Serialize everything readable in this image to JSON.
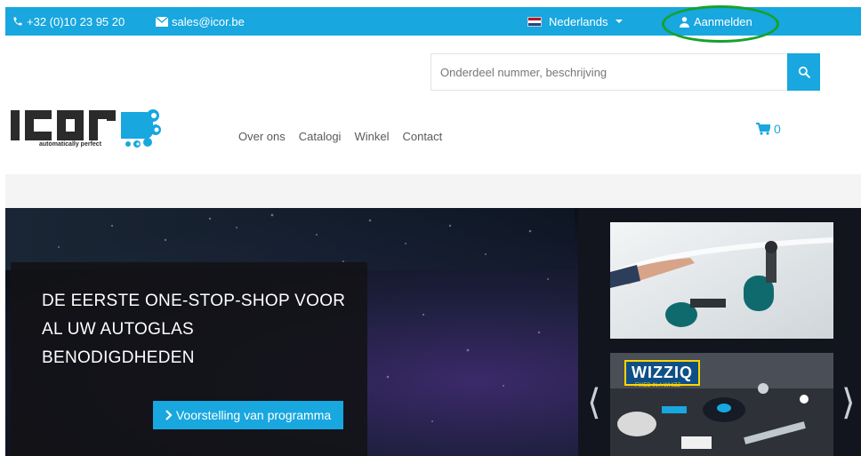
{
  "topbar": {
    "phone": "+32 (0)10 23 95 20",
    "email": "sales@icor.be",
    "language": "Nederlands",
    "login": "Aanmelden",
    "icons": {
      "phone": "phone-icon",
      "email": "envelope-icon",
      "flag": "netherlands-flag-icon",
      "login": "user-icon"
    }
  },
  "search": {
    "placeholder": "Onderdeel nummer, beschrijving",
    "value": "",
    "button_icon": "search-icon"
  },
  "logo": {
    "brand": "icor",
    "tagline": "automatically perfect"
  },
  "nav": {
    "items": [
      "Over ons",
      "Catalogi",
      "Winkel",
      "Contact"
    ]
  },
  "cart": {
    "count": "0",
    "icon": "cart-icon"
  },
  "hero": {
    "tagline_lines": [
      "DE EERSTE ONE-STOP-SHOP VOOR",
      "AL UW AUTOGLAS",
      "BENODIGDHEDEN"
    ],
    "cta_label": "Voorstelling van programma",
    "thumb2_brand": "WIZZIQ",
    "thumb2_sub": "FIXED IN A WHIZZ",
    "prev_label": "⟨",
    "next_label": "⟩"
  },
  "colors": {
    "accent": "#18a7df",
    "highlight_circle": "#17a12b",
    "logo_dark": "#2b2b2b"
  }
}
